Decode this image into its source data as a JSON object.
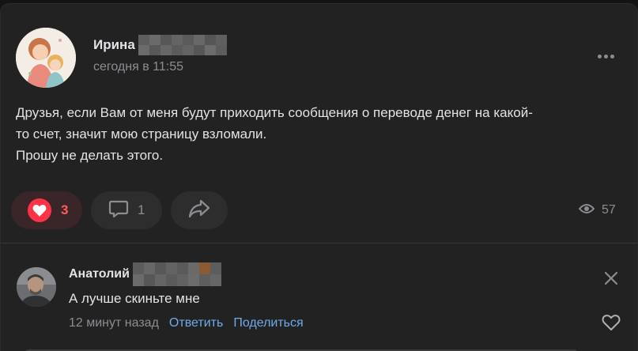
{
  "post": {
    "author_name": "Ирина",
    "time": "сегодня в 11:55",
    "text": "Друзья, если Вам от меня будут приходить сообщения о переводе денег на какой-\nто счет, значит мою страницу взломали.\nПрошу не делать этого.",
    "likes": "3",
    "comments": "1",
    "views": "57"
  },
  "comment": {
    "author_name": "Анатолий",
    "text": "А лучше скиньте мне",
    "time": "12 минут назад",
    "reply_label": "Ответить",
    "share_label": "Поделиться"
  },
  "icons": {
    "more": "more-horizontal-icon",
    "like": "heart-icon",
    "comment": "comment-icon",
    "share": "share-arrow-icon",
    "views": "eye-icon",
    "close": "close-icon",
    "comment_like": "heart-outline-icon"
  },
  "colors": {
    "background": "#141414",
    "card": "#222222",
    "like_active": "#ff3347",
    "link": "#71aaeb",
    "secondary_text": "#8b8d92"
  }
}
